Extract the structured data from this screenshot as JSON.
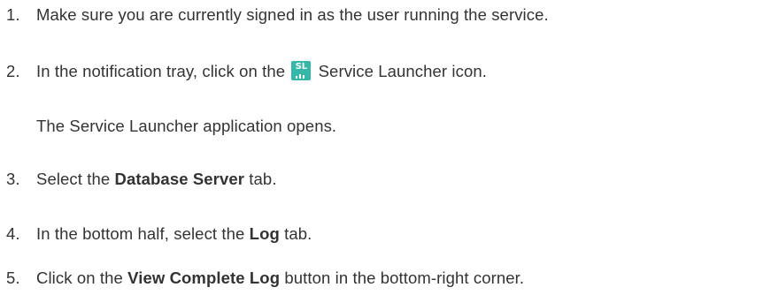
{
  "steps": [
    {
      "number": "1.",
      "parts": [
        "Make sure you are currently signed in as the user running the service."
      ]
    },
    {
      "number": "2.",
      "parts": [
        "In the notification tray, click on the",
        "Service Launcher icon."
      ],
      "icon": {
        "name": "service-launcher-icon",
        "text": "SL",
        "color": "#35b7a9"
      },
      "result": "The Service Launcher application opens."
    },
    {
      "number": "3.",
      "parts": [
        "Select the",
        "Database Server",
        "tab."
      ]
    },
    {
      "number": "4.",
      "parts": [
        "In the bottom half, select the",
        "Log",
        "tab."
      ]
    },
    {
      "number": "5.",
      "parts": [
        "Click on the",
        "View Complete Log",
        "button in the bottom-right corner."
      ]
    }
  ]
}
